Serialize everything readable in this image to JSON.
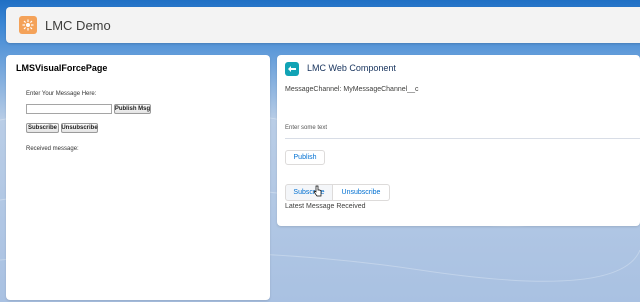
{
  "header": {
    "app_title": "LMC Demo",
    "app_icon": "app-launcher-icon",
    "accent": "#f4a259"
  },
  "vf_panel": {
    "title": "LMSVisualForcePage",
    "input_label": "Enter Your Message Here:",
    "input_value": "",
    "publish_label": "Publish Msg",
    "subscribe_label": "Subscribe",
    "unsubscribe_label": "Unsubscribe",
    "received_label": "Received message:"
  },
  "lwc_panel": {
    "icon": "lightning-component-icon",
    "title": "LMC Web Component",
    "channel_text": "MessageChannel: MyMessageChannel__c",
    "input_placeholder": "Enter some text",
    "publish_label": "Publish",
    "subscribe_label": "Subscribe",
    "unsubscribe_label": "Unsubscribe",
    "latest_label": "Latest Message Received",
    "accent": "#0070d2",
    "icon_color": "#11a3b5"
  }
}
